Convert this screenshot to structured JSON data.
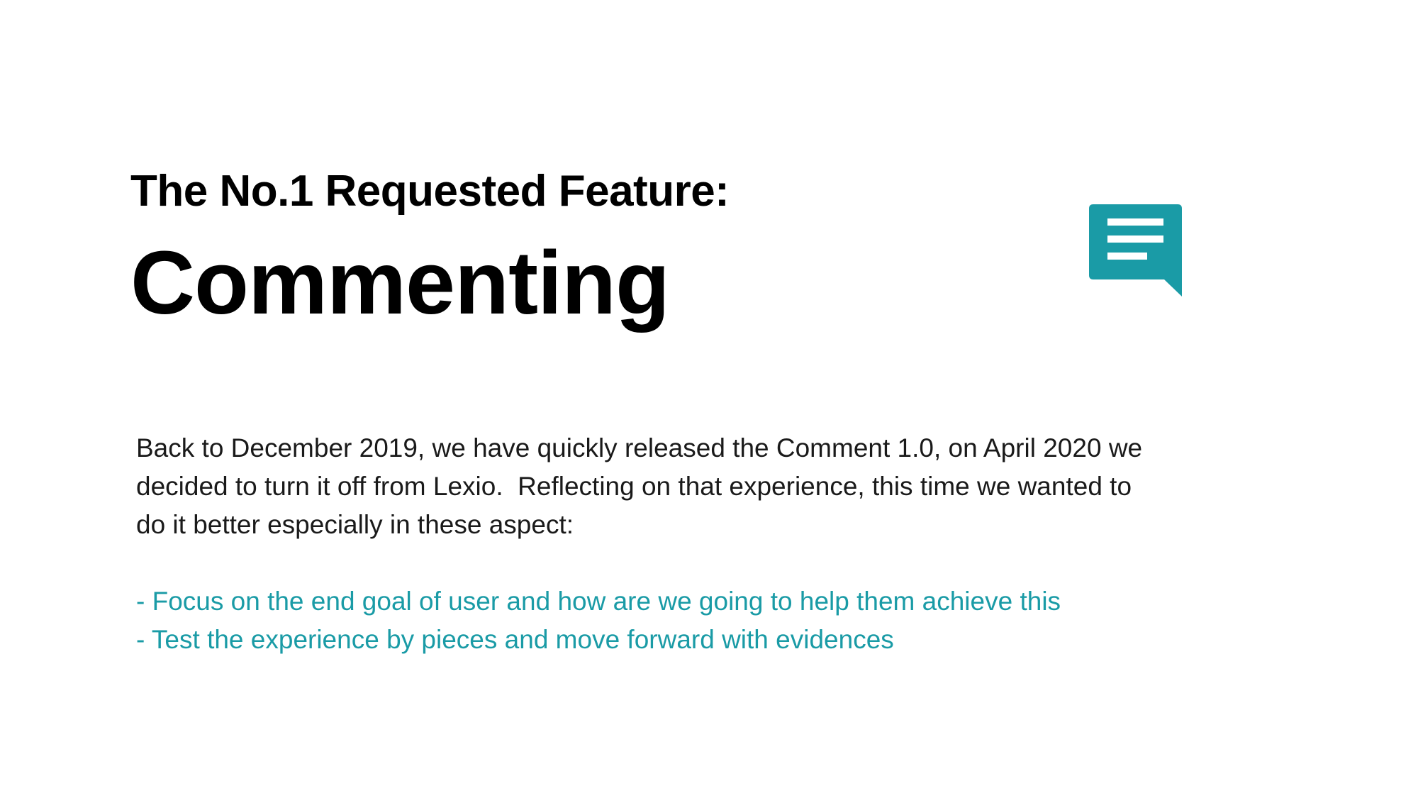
{
  "slide": {
    "subtitle": "The No.1 Requested Feature:",
    "title": "Commenting",
    "icon": "comment-bubble-icon",
    "accent_color": "#1a9ba6",
    "intro_line_1": "Back to December 2019, we have quickly released the Comment 1.0, on April 2020 we",
    "intro_line_2": "decided to turn it off from Lexio.  Reflecting on that experience, this time we wanted to",
    "intro_line_3": "do it better especially in these aspect:",
    "bullets": [
      "- Focus on the end goal of user and how are we going to help them achieve this",
      "- Test the experience by pieces and move forward with evidences"
    ]
  }
}
